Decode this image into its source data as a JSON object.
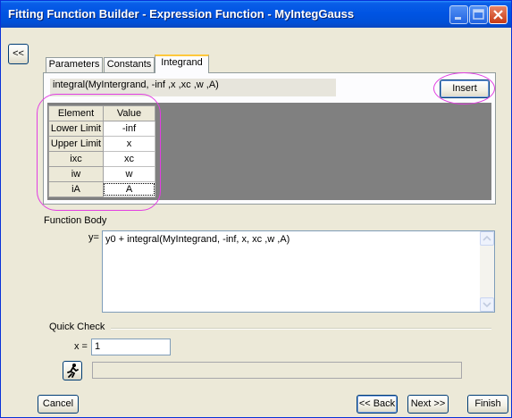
{
  "window": {
    "title": "Fitting Function Builder - Expression Function - MyIntegGauss"
  },
  "collapse_button": {
    "label": "<<"
  },
  "tabs": [
    {
      "label": "Parameters",
      "active": false
    },
    {
      "label": "Constants",
      "active": false
    },
    {
      "label": "Integrand",
      "active": true
    }
  ],
  "integrand": {
    "expression": "integral(MyIntergrand, -inf ,x ,xc ,w ,A)",
    "insert_label": "Insert",
    "table": {
      "headers": [
        "Element",
        "Value"
      ],
      "rows": [
        {
          "element": "Lower Limit",
          "value": "-inf"
        },
        {
          "element": "Upper Limit",
          "value": "x"
        },
        {
          "element": "ixc",
          "value": "xc"
        },
        {
          "element": "iw",
          "value": "w"
        },
        {
          "element": "iA",
          "value": "A"
        }
      ]
    }
  },
  "function_body": {
    "label": "Function Body",
    "y_label": "y=",
    "text": "y0 + integral(MyIntegrand, -inf, x, xc ,w ,A)"
  },
  "quick_check": {
    "label": "Quick Check",
    "x_label": "x =",
    "x_value": "1",
    "result": ""
  },
  "footer": {
    "cancel": "Cancel",
    "back": "<< Back",
    "next": "Next >>",
    "finish": "Finish"
  },
  "colors": {
    "titlebar": "#0054e3",
    "dialog_bg": "#ece9d8",
    "highlight": "#e23ee2",
    "tab_accent": "#ffc83c"
  },
  "icons": [
    "minimize-icon",
    "maximize-icon",
    "close-icon",
    "run-icon"
  ]
}
